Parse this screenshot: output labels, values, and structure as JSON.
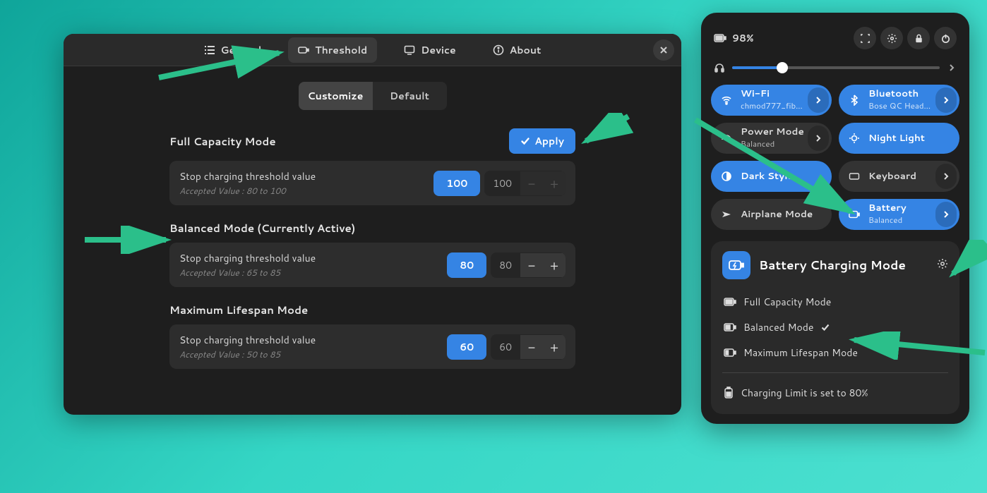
{
  "settings": {
    "tabs": {
      "general": "General",
      "threshold": "Threshold",
      "device": "Device",
      "about": "About"
    },
    "segmented": {
      "customize": "Customize",
      "default": "Default"
    },
    "full": {
      "title": "Full Capacity Mode",
      "apply": "Apply",
      "row_label": "Stop charging threshold value",
      "row_sub": "Accepted Value : 80 to 100",
      "chip": "100",
      "stepper_val": "100"
    },
    "balanced": {
      "title": "Balanced Mode (Currently Active)",
      "row_label": "Stop charging threshold value",
      "row_sub": "Accepted Value : 65 to 85",
      "chip": "80",
      "stepper_val": "80"
    },
    "max": {
      "title": "Maximum Lifespan Mode",
      "row_label": "Stop charging threshold value",
      "row_sub": "Accepted Value : 50 to 85",
      "chip": "60",
      "stepper_val": "60"
    }
  },
  "qs": {
    "battery_pct": "98%",
    "volume_pct": 24,
    "wifi": {
      "title": "Wi-Fi",
      "sub": "chmod777_fib…"
    },
    "bluetooth": {
      "title": "Bluetooth",
      "sub": "Bose QC Head…"
    },
    "power": {
      "title": "Power Mode",
      "sub": "Balanced"
    },
    "night": "Night Light",
    "dark": "Dark Style",
    "keyboard": "Keyboard",
    "airplane": "Airplane Mode",
    "battery_toggle": {
      "title": "Battery",
      "sub": "Balanced"
    },
    "charging": {
      "title": "Battery Charging Mode",
      "full": "Full Capacity Mode",
      "balanced": "Balanced Mode",
      "max": "Maximum Lifespan Mode",
      "status": "Charging Limit is set to 80%"
    }
  },
  "colors": {
    "accent": "#3584e4"
  }
}
